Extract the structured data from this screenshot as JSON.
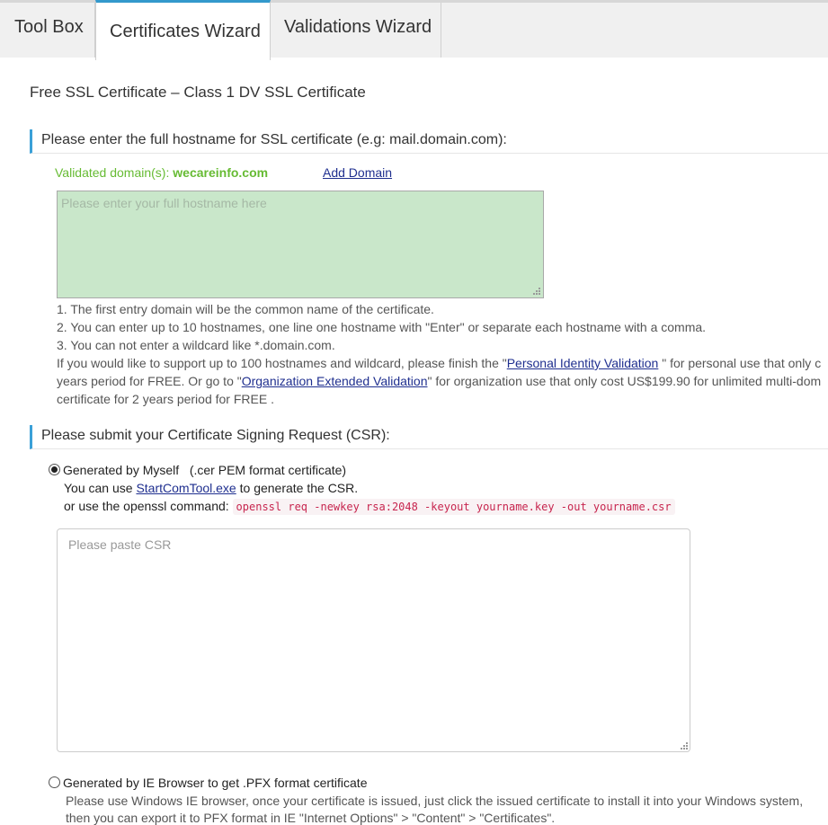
{
  "tabs": [
    {
      "label": "Tool Box"
    },
    {
      "label": "Certificates Wizard"
    },
    {
      "label": "Validations Wizard"
    }
  ],
  "page_title": "Free SSL Certificate – Class 1 DV SSL Certificate",
  "hostname_section": {
    "heading": "Please enter the full hostname for SSL certificate (e.g: mail.domain.com):",
    "validated_label": "Validated domain(s):",
    "validated_domain": "wecareinfo.com",
    "add_domain": "Add Domain",
    "placeholder": "Please enter your full hostname here",
    "value": "",
    "bg_color": "#c9e7ca",
    "notes": [
      "1. The first entry domain will be the common name of the certificate.",
      "2. You can enter up to 10 hostnames, one line one hostname with \"Enter\" or separate each hostname with a comma.",
      "3. You can not enter a wildcard like *.domain.com."
    ],
    "extra_p1_a": "If you would like to support up to 100 hostnames and wildcard, please finish the \"",
    "extra_link1": "Personal Identity Validation",
    "extra_p1_b": " \" for personal use that only c",
    "extra_p2_a": "years period for FREE. Or go to \"",
    "extra_link2": "Organization Extended Validation",
    "extra_p2_b": "\" for organization use that only cost US$199.90 for unlimited multi-dom",
    "extra_p3": "certificate for 2 years period for FREE ."
  },
  "csr_section": {
    "heading": "Please submit your Certificate Signing Request (CSR):",
    "option1_label": "Generated by Myself   (.cer PEM format certificate)",
    "option1_checked": true,
    "tool_text_a": "You can use ",
    "tool_link": "StartComTool.exe",
    "tool_text_b": " to generate the CSR.",
    "openssl_text": "or use the openssl command: ",
    "openssl_cmd": "openssl req -newkey rsa:2048 -keyout yourname.key -out yourname.csr",
    "csr_placeholder": "Please paste CSR",
    "csr_value": "",
    "option2_label": "Generated by IE Browser to get .PFX format certificate",
    "option2_checked": false,
    "option2_note": "Please use Windows IE browser, once your certificate is issued, just click the issued certificate to install it into your Windows system,",
    "option2_note2": "then you can export it to PFX format in IE \"Internet Options\" > \"Content\" > \"Certificates\"."
  },
  "colors": {
    "accent": "#3aa0d8",
    "validated_green": "#66bb33",
    "link": "#1f2f8f",
    "code": "#c7254e"
  }
}
